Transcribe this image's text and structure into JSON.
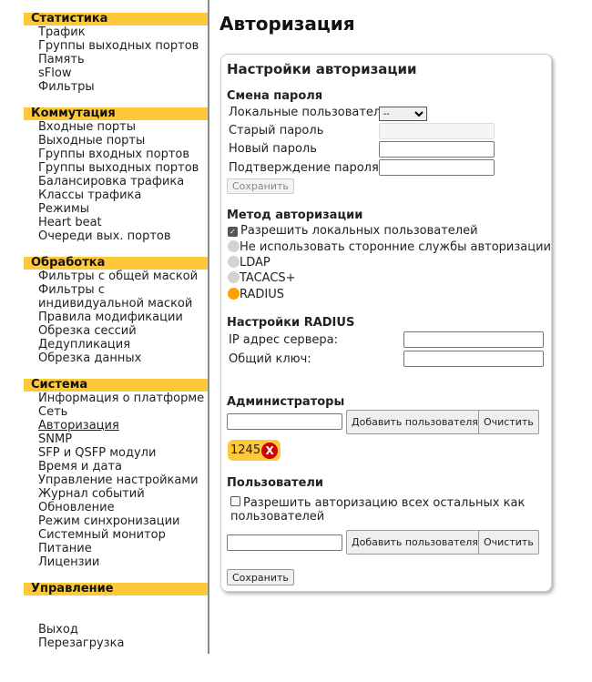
{
  "sidebar": {
    "groups": [
      {
        "title": "Статистика",
        "items": [
          "Трафик",
          "Группы выходных портов",
          "Память",
          "sFlow",
          "Фильтры"
        ]
      },
      {
        "title": "Коммутация",
        "items": [
          "Входные порты",
          "Выходные порты",
          "Группы входных портов",
          "Группы выходных портов",
          "Балансировка трафика",
          "Классы трафика",
          "Режимы",
          "Heart beat",
          "Очереди вых. портов"
        ]
      },
      {
        "title": "Обработка",
        "items": [
          "Фильтры с общей маской",
          "Фильтры с индивидуальной маской",
          "Правила модификации",
          "Обрезка сессий",
          "Дедупликация",
          "Обрезка данных"
        ]
      },
      {
        "title": "Система",
        "items": [
          "Информация о платформе",
          "Сеть",
          "Авторизация",
          "SNMP",
          "SFP и QSFP модули",
          "Время и дата",
          "Управление настройками",
          "Журнал событий",
          "Обновление",
          "Режим синхронизации",
          "Системный монитор",
          "Питание",
          "Лицензии"
        ]
      },
      {
        "title": "Управление",
        "items": [
          "Выход",
          "Перезагрузка"
        ]
      }
    ],
    "active_item": "Авторизация"
  },
  "page": {
    "title": "Авторизация"
  },
  "card": {
    "title": "Настройки авторизации",
    "password": {
      "section": "Смена пароля",
      "local_users_label": "Локальные пользователи",
      "local_users_value": "--",
      "old_label": "Старый пароль",
      "new_label": "Новый пароль",
      "confirm_label": "Подтверждение пароля",
      "save_label": "Сохранить"
    },
    "method": {
      "section": "Метод авторизации",
      "allow_local_label": "Разрешить локальных пользователей",
      "allow_local_checked": true,
      "options": [
        "Не использовать сторонние службы авторизации",
        "LDAP",
        "TACACS+",
        "RADIUS"
      ],
      "selected": "RADIUS"
    },
    "radius": {
      "section": "Настройки RADIUS",
      "ip_label": "IP адрес сервера:",
      "key_label": "Общий ключ:"
    },
    "admins": {
      "section": "Администраторы",
      "add_label": "Добавить пользователя",
      "clear_label": "Очистить",
      "tags": [
        "1245"
      ],
      "remove_glyph": "X"
    },
    "users": {
      "section": "Пользователи",
      "allow_all_label": "Разрешить авторизацию всех остальных как пользователей",
      "allow_all_checked": false,
      "add_label": "Добавить пользователя",
      "clear_label": "Очистить"
    },
    "save_label": "Сохранить"
  },
  "colors": {
    "accent": "#fdc83a",
    "radio_selected": "#ff9f00",
    "remove": "#d40000"
  }
}
